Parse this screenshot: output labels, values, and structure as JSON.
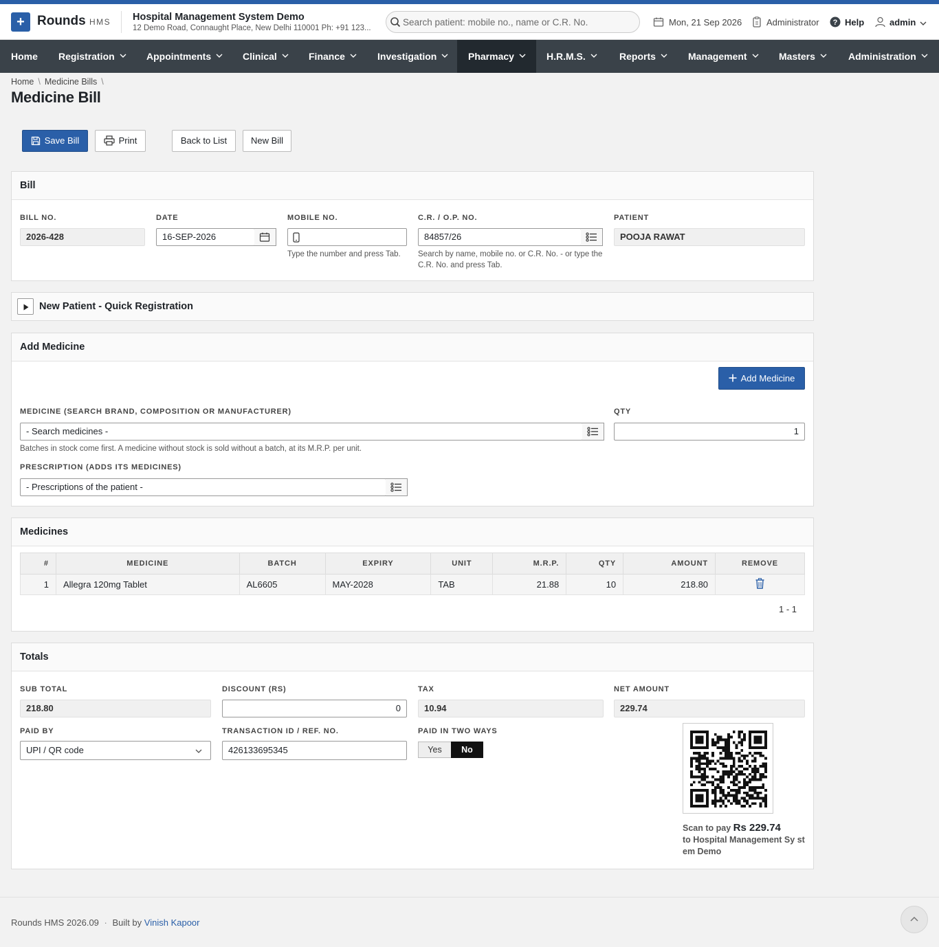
{
  "header": {
    "brand": "Rounds",
    "brand_sub": "HMS",
    "org_name": "Hospital Management System Demo",
    "org_address": "12 Demo Road, Connaught Place, New Delhi 110001 Ph: +91 123...",
    "search_placeholder": "Search patient: mobile no., name or C.R. No.",
    "date": "Mon, 21 Sep 2026",
    "role": "Administrator",
    "help": "Help",
    "user": "admin"
  },
  "nav": {
    "items": [
      "Home",
      "Registration",
      "Appointments",
      "Clinical",
      "Finance",
      "Investigation",
      "Pharmacy",
      "H.R.M.S.",
      "Reports",
      "Management",
      "Masters",
      "Administration"
    ],
    "active": "Pharmacy"
  },
  "breadcrumb": {
    "home": "Home",
    "section": "Medicine Bills"
  },
  "page_title": "Medicine Bill",
  "toolbar": {
    "save": "Save Bill",
    "print": "Print",
    "back": "Back to List",
    "new": "New Bill"
  },
  "bill": {
    "heading": "Bill",
    "bill_no_label": "Bill No.",
    "bill_no": "2026-428",
    "date_label": "Date",
    "date": "16-SEP-2026",
    "mobile_label": "Mobile No.",
    "mobile": "",
    "mobile_help": "Type the number and press Tab.",
    "cr_label": "C.R. / O.P. No.",
    "cr": "84857/26",
    "cr_help": "Search by name, mobile no. or C.R. No. - or type the C.R. No. and press Tab.",
    "patient_label": "Patient",
    "patient": "POOJA RAWAT"
  },
  "quick_reg": {
    "heading": "New Patient - Quick Registration"
  },
  "add_medicine": {
    "heading": "Add Medicine",
    "button": "Add Medicine",
    "medicine_label": "Medicine (search brand, composition or manufacturer)",
    "medicine_placeholder": "- Search medicines -",
    "medicine_help": "Batches in stock come first. A medicine without stock is sold without a batch, at its M.R.P. per unit.",
    "qty_label": "Qty",
    "qty": "1",
    "prescription_label": "Prescription (adds its medicines)",
    "prescription_placeholder": "- Prescriptions of the patient -"
  },
  "medicines": {
    "heading": "Medicines",
    "columns": [
      "#",
      "MEDICINE",
      "BATCH",
      "EXPIRY",
      "UNIT",
      "M.R.P.",
      "QTY",
      "AMOUNT",
      "REMOVE"
    ],
    "rows": [
      {
        "no": "1",
        "medicine": "Allegra 120mg Tablet",
        "batch": "AL6605",
        "expiry": "MAY-2028",
        "unit": "TAB",
        "mrp": "21.88",
        "qty": "10",
        "amount": "218.80"
      }
    ],
    "pager": "1 - 1"
  },
  "totals": {
    "heading": "Totals",
    "subtotal_label": "Sub Total",
    "subtotal": "218.80",
    "discount_label": "Discount (Rs)",
    "discount": "0",
    "tax_label": "Tax",
    "tax": "10.94",
    "net_label": "Net Amount",
    "net": "229.74",
    "paid_by_label": "Paid By",
    "paid_by": "UPI / QR code",
    "txn_label": "Transaction ID / Ref. No.",
    "txn": "426133695345",
    "two_ways_label": "Paid in two ways",
    "yes": "Yes",
    "no": "No",
    "scan_prefix": "Scan to pay",
    "scan_amount": "Rs 229.74",
    "scan_to": "to Hospital Management Sy stem Demo"
  },
  "footer": {
    "version": "Rounds HMS 2026.09",
    "built_by": "Built by",
    "author": "Vinish Kapoor"
  },
  "colors": {
    "primary": "#2a5fa8",
    "nav_bg": "#3a4249",
    "nav_active": "#22292f"
  }
}
